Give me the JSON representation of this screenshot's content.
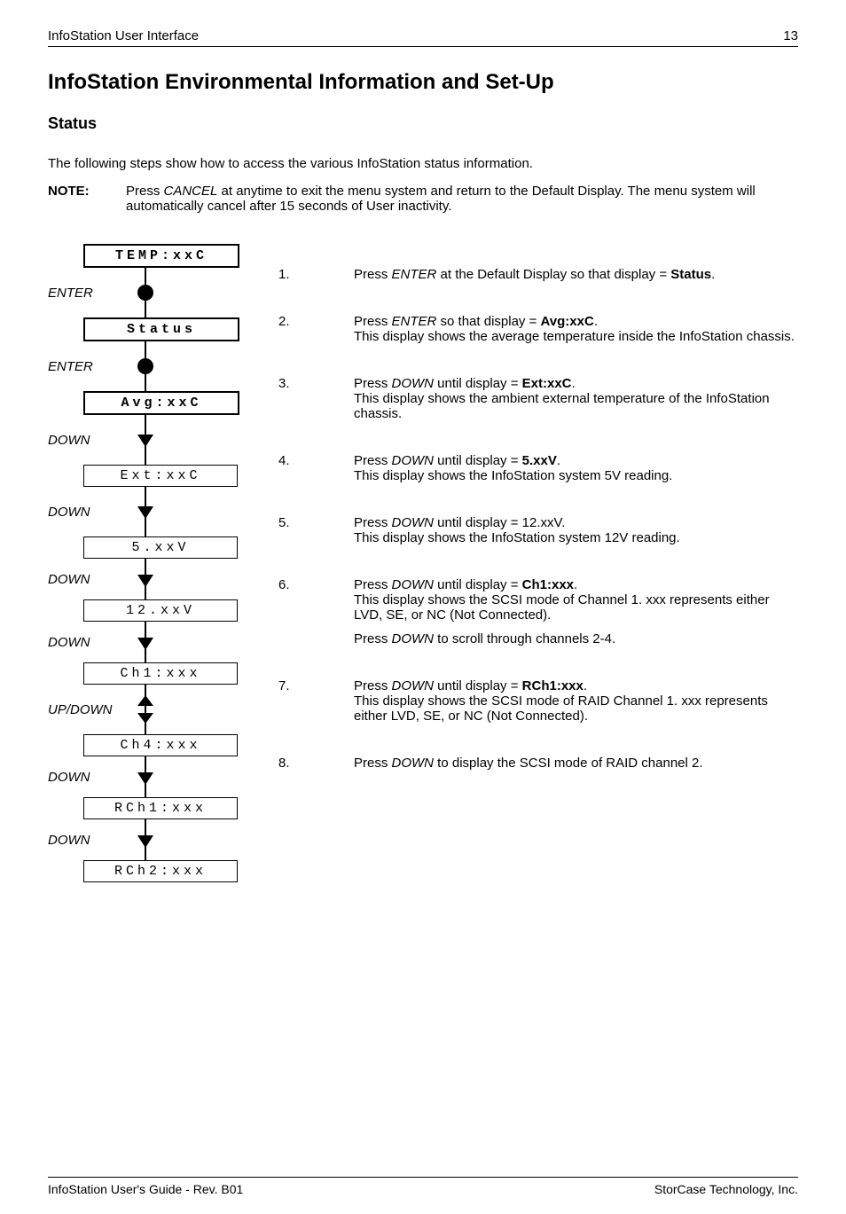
{
  "header": {
    "left": "InfoStation User Interface",
    "right": "13"
  },
  "h1": "InfoStation Environmental Information and Set-Up",
  "h2": "Status",
  "intro": "The following steps show how to access the various InfoStation status information.",
  "note": {
    "label": "NOTE:",
    "text_a": "Press ",
    "text_em": "CANCEL",
    "text_b": " at anytime to exit the menu system and return to the Default Display. The menu system will automatically cancel after 15 seconds of User inactivity."
  },
  "diagram": {
    "d1": "TEMP:xxC",
    "a1": "ENTER",
    "d2": "Status",
    "a2": "ENTER",
    "d3": "Avg:xxC",
    "a3": "DOWN",
    "d4": "Ext:xxC",
    "a4": "DOWN",
    "d5": "5.xxV",
    "a5": "DOWN",
    "d6": "12.xxV",
    "a6": "DOWN",
    "d7": "Ch1:xxx",
    "a7": "UP/DOWN",
    "d8": "Ch4:xxx",
    "a8": "DOWN",
    "d9": "RCh1:xxx",
    "a9": "DOWN",
    "d10": "RCh2:xxx"
  },
  "steps": {
    "s1n": "1.",
    "s1a": "Press ",
    "s1em": "ENTER",
    "s1b": " at the Default Display so that display = ",
    "s1st": "Status",
    "s1c": ".",
    "s2n": "2.",
    "s2a": "Press ",
    "s2em": "ENTER",
    "s2b": " so that display = ",
    "s2st": "Avg:xxC",
    "s2c": ".",
    "s2d": "This display shows the average temperature inside the InfoStation chassis.",
    "s3n": "3.",
    "s3a": "Press ",
    "s3em": "DOWN",
    "s3b": " until display = ",
    "s3st": "Ext:xxC",
    "s3c": ".",
    "s3d": "This display shows the ambient external temperature of the InfoStation chassis.",
    "s4n": "4.",
    "s4a": "Press ",
    "s4em": "DOWN",
    "s4b": " until display = ",
    "s4st": "5.xxV",
    "s4c": ".",
    "s4d": "This display shows the InfoStation system 5V reading.",
    "s5n": "5.",
    "s5a": "Press ",
    "s5em": "DOWN",
    "s5b": " until display = 12.xxV.",
    "s5d": "This display shows the InfoStation system 12V reading.",
    "s6n": "6.",
    "s6a": "Press ",
    "s6em": "DOWN",
    "s6b": " until display = ",
    "s6st": "Ch1:xxx",
    "s6c": ".",
    "s6d": "This display shows the SCSI mode of Channel 1. xxx represents either LVD, SE, or NC (Not Connected).",
    "s6e_a": "Press ",
    "s6e_em": "DOWN",
    "s6e_b": " to scroll through channels 2-4.",
    "s7n": "7.",
    "s7a": "Press ",
    "s7em": "DOWN",
    "s7b": " until display = ",
    "s7st": "RCh1:xxx",
    "s7c": ".",
    "s7d": "This display shows the SCSI mode of RAID Channel 1.  xxx represents either LVD, SE, or NC (Not Connected).",
    "s8n": "8.",
    "s8a": "Press ",
    "s8em": "DOWN",
    "s8b": " to display the SCSI mode of RAID channel 2."
  },
  "footer": {
    "left": "InfoStation User's Guide - Rev. B01",
    "right": "StorCase Technology, Inc."
  }
}
